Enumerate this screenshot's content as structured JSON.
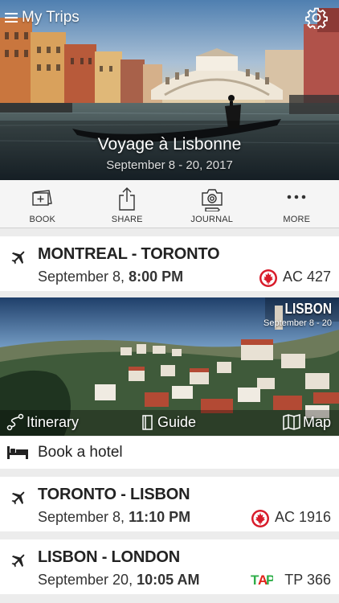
{
  "header": {
    "menu_label": "My Trips",
    "menu_icon": "hamburger-icon",
    "settings_icon": "gear-icon"
  },
  "trip": {
    "title": "Voyage à Lisbonne",
    "dates": "September 8 - 20, 2017"
  },
  "actions": [
    {
      "label": "BOOK",
      "icon": "book-icon"
    },
    {
      "label": "SHARE",
      "icon": "share-icon"
    },
    {
      "label": "JOURNAL",
      "icon": "camera-icon"
    },
    {
      "label": "MORE",
      "icon": "more-icon"
    }
  ],
  "flights": [
    {
      "route": "MONTREAL - TORONTO",
      "date": "September 8, ",
      "time": "8:00 PM",
      "code": "AC 427",
      "airline_icon": "air-canada-icon"
    },
    {
      "route": "TORONTO - LISBON",
      "date": "September 8, ",
      "time": "11:10 PM",
      "code": "AC 1916",
      "airline_icon": "air-canada-icon"
    },
    {
      "route": "LISBON - LONDON",
      "date": "September 20, ",
      "time": "10:05 AM",
      "code": "TP 366",
      "airline_icon": "tap-portugal-icon"
    }
  ],
  "destination": {
    "city": "LISBON",
    "dates": "September 8 - 20",
    "links": {
      "itinerary": "Itinerary",
      "guide": "Guide",
      "map": "Map"
    }
  },
  "hotel": {
    "label": "Book a hotel",
    "icon": "bed-icon"
  },
  "colors": {
    "air_canada_red": "#d81b2a",
    "tap_green": "#2fae4a",
    "tap_red": "#e2231a"
  }
}
